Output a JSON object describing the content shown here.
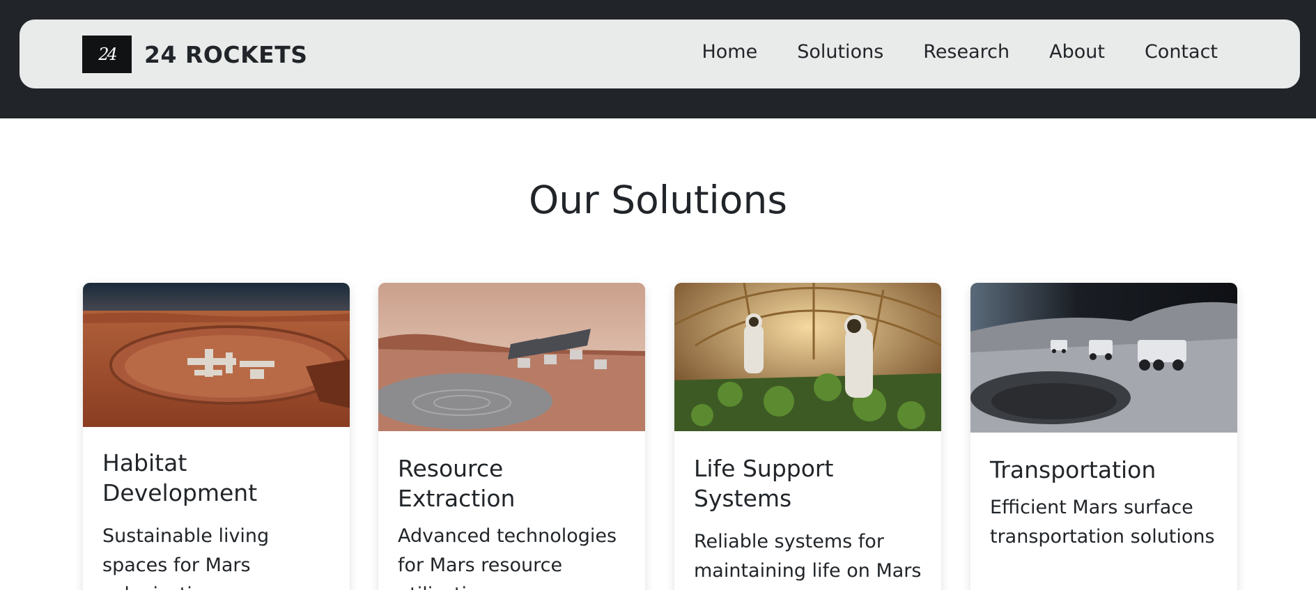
{
  "brand": {
    "logo_text": "24",
    "name": "24 ROCKETS"
  },
  "nav": {
    "items": [
      "Home",
      "Solutions",
      "Research",
      "About",
      "Contact"
    ]
  },
  "section": {
    "title": "Our Solutions"
  },
  "cards": [
    {
      "title": "Habitat Development",
      "text": "Sustainable living spaces for Mars colonization",
      "image": "mars-habitat-image"
    },
    {
      "title": "Resource Extraction",
      "text": "Advanced technologies for Mars resource utilization",
      "image": "solar-water-extraction-image"
    },
    {
      "title": "Life Support Systems",
      "text": "Reliable systems for maintaining life on Mars",
      "image": "greenhouse-astronauts-image"
    },
    {
      "title": "Transportation",
      "text": "Efficient Mars surface transportation solutions",
      "image": "rover-convoy-image"
    }
  ],
  "colors": {
    "topbar": "#212429",
    "navbar": "#e9eaea",
    "text": "#212529",
    "logo_bg": "#111214"
  }
}
